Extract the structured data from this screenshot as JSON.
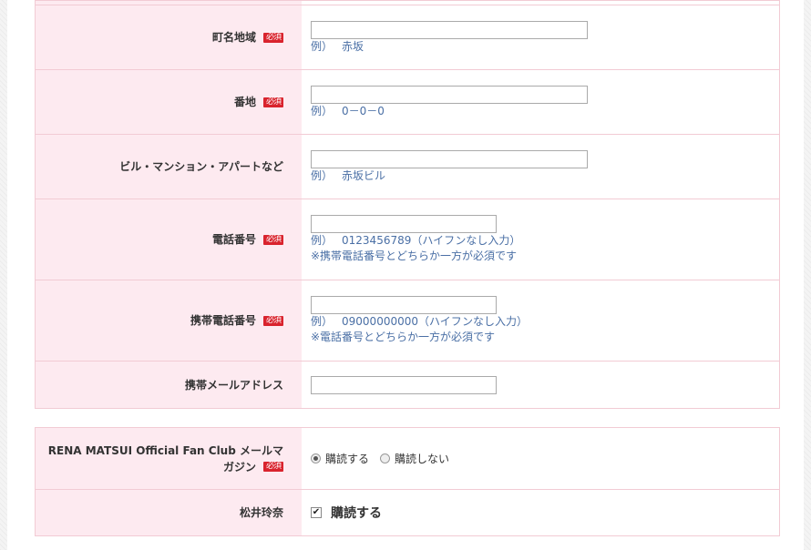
{
  "required_badge": "必須",
  "address_rows": [
    {
      "label": "町名地域",
      "required": true,
      "hint_prefix": "例）",
      "hint": "赤坂"
    },
    {
      "label": "番地",
      "required": true,
      "hint_prefix": "例）",
      "hint": "0－0－0"
    },
    {
      "label": "ビル・マンション・アパートなど",
      "required": false,
      "hint_prefix": "例）",
      "hint": "赤坂ビル"
    }
  ],
  "phone": {
    "label": "電話番号",
    "hint_prefix": "例）",
    "hint": "0123456789（ハイフンなし入力）",
    "note": "※携帯電話番号とどちらか一方が必須です"
  },
  "mobile": {
    "label": "携帯電話番号",
    "hint_prefix": "例）",
    "hint": "09000000000（ハイフンなし入力）",
    "note": "※電話番号とどちらか一方が必須です"
  },
  "mobile_email": {
    "label": "携帯メールアドレス"
  },
  "newsletter": {
    "label_line1": "RENA MATSUI Official Fan Club メールマ",
    "label_line2": "ガジン",
    "opt_subscribe": "購読する",
    "opt_unsubscribe": "購読しない",
    "selected": "購読する"
  },
  "matsui": {
    "label": "松井玲奈",
    "checkbox_label": "購読する",
    "checked": true
  }
}
